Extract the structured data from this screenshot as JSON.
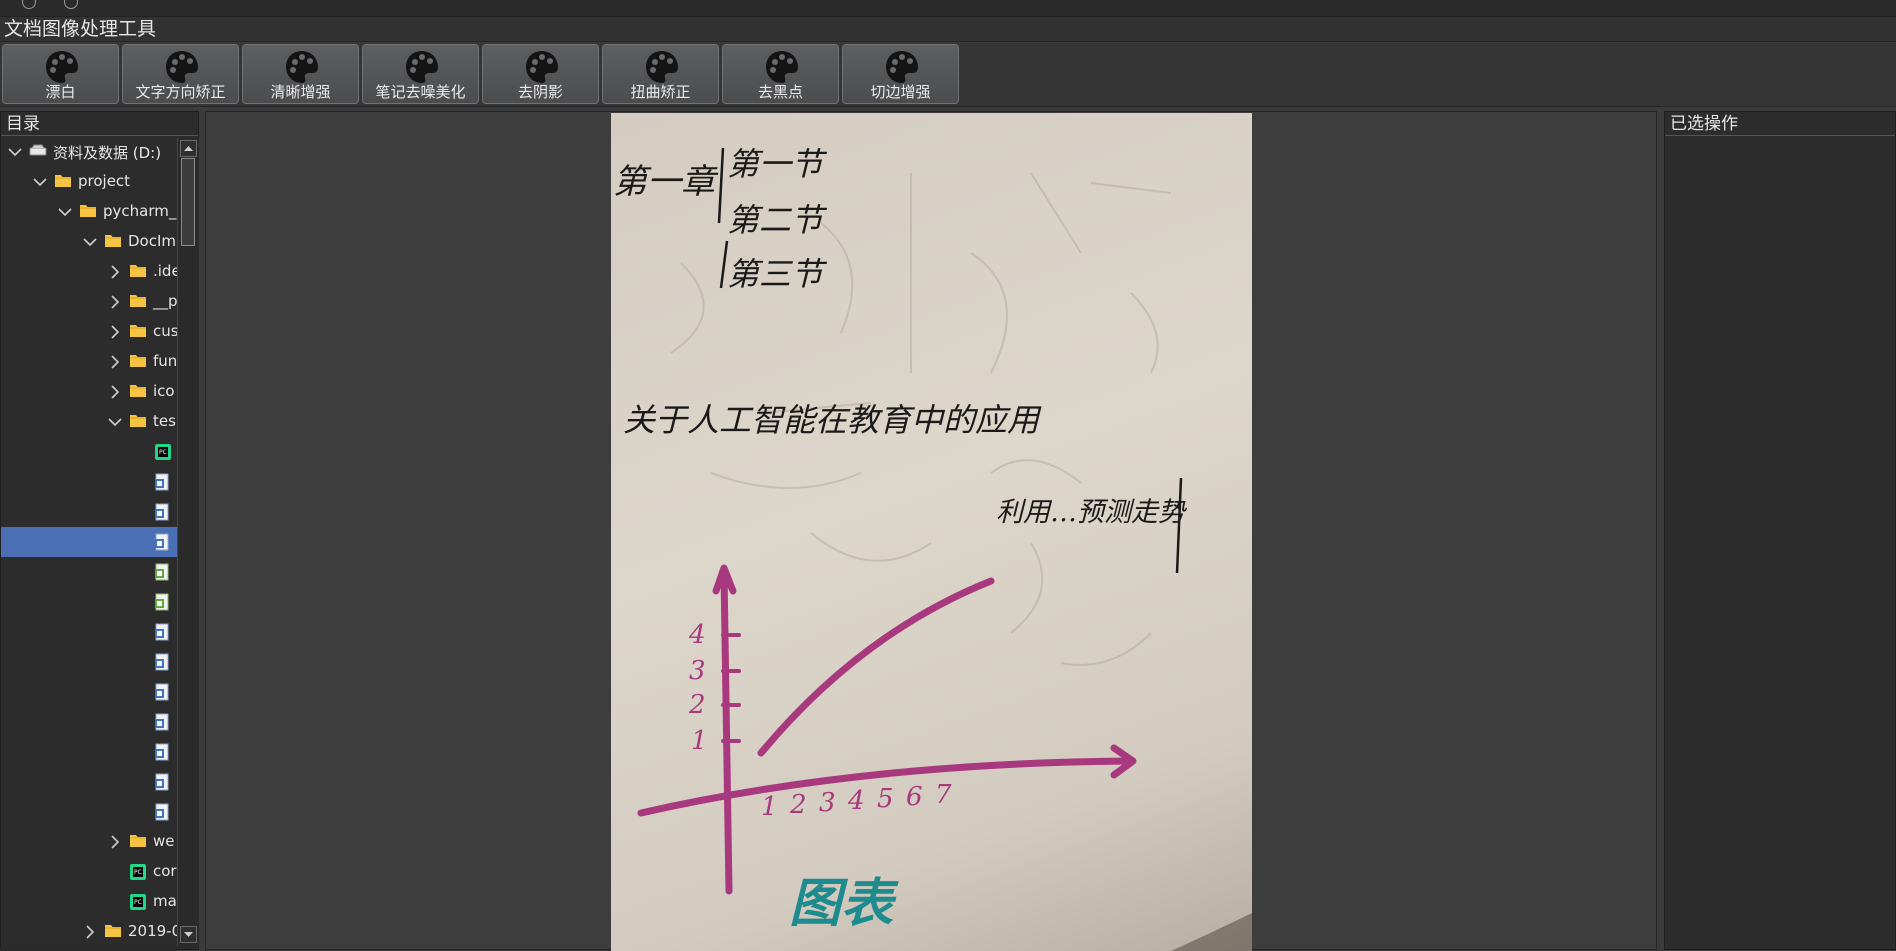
{
  "app": {
    "title": "文档图像处理工具"
  },
  "toolbar": {
    "buttons": [
      {
        "label": "漂白"
      },
      {
        "label": "文字方向矫正"
      },
      {
        "label": "清晰增强"
      },
      {
        "label": "笔记去噪美化"
      },
      {
        "label": "去阴影"
      },
      {
        "label": "扭曲矫正"
      },
      {
        "label": "去黑点"
      },
      {
        "label": "切边增强"
      }
    ]
  },
  "directory": {
    "title": "目录",
    "items": [
      {
        "label": "资料及数据 (D:)",
        "icon": "drive-icon",
        "expand": "down"
      },
      {
        "label": "project",
        "icon": "folder-icon",
        "expand": "down"
      },
      {
        "label": "pycharm_",
        "icon": "folder-icon",
        "expand": "down"
      },
      {
        "label": "DocIm",
        "icon": "folder-icon",
        "expand": "down"
      },
      {
        "label": ".ide",
        "icon": "folder-icon",
        "expand": "right"
      },
      {
        "label": "__p",
        "icon": "folder-icon",
        "expand": "right"
      },
      {
        "label": "cus",
        "icon": "folder-icon",
        "expand": "right"
      },
      {
        "label": "fun",
        "icon": "folder-icon",
        "expand": "right"
      },
      {
        "label": "ico",
        "icon": "folder-icon",
        "expand": "right"
      },
      {
        "label": "tes",
        "icon": "folder-icon",
        "expand": "down"
      },
      {
        "label": "",
        "icon": "pycharm-file-icon",
        "expand": ""
      },
      {
        "label": "",
        "icon": "image-file-icon",
        "expand": ""
      },
      {
        "label": "",
        "icon": "image-file-icon",
        "expand": ""
      },
      {
        "label": "",
        "icon": "image-file-icon",
        "expand": "",
        "selected": true
      },
      {
        "label": "",
        "icon": "green-file-icon",
        "expand": ""
      },
      {
        "label": "",
        "icon": "green-file-icon",
        "expand": ""
      },
      {
        "label": "",
        "icon": "image-file-icon",
        "expand": ""
      },
      {
        "label": "",
        "icon": "image-file-icon",
        "expand": ""
      },
      {
        "label": "",
        "icon": "image-file-icon",
        "expand": ""
      },
      {
        "label": "",
        "icon": "image-file-icon",
        "expand": ""
      },
      {
        "label": "",
        "icon": "image-file-icon",
        "expand": ""
      },
      {
        "label": "",
        "icon": "image-file-icon",
        "expand": ""
      },
      {
        "label": "",
        "icon": "image-file-icon",
        "expand": ""
      },
      {
        "label": "we",
        "icon": "folder-icon",
        "expand": "right"
      },
      {
        "label": "cor",
        "icon": "pycharm-file-icon",
        "expand": ""
      },
      {
        "label": "ma",
        "icon": "pycharm-file-icon",
        "expand": ""
      },
      {
        "label": "2019-0",
        "icon": "folder-icon",
        "expand": "right"
      }
    ]
  },
  "selected_ops": {
    "title": "已选操作"
  },
  "document": {
    "line1_chapter": "第一章",
    "line1_section": "第一节",
    "line2": "第二节",
    "line3": "第三节",
    "sentence": "关于人工智能在教育中的应用",
    "trend_note": "利用…预测走势",
    "chart_caption": "图表",
    "y_ticks": [
      "4",
      "3",
      "2",
      "1"
    ],
    "x_ticks": [
      "1",
      "2",
      "3",
      "4",
      "5",
      "6",
      "7"
    ]
  },
  "colors": {
    "accent_selected": "#4a6fb4",
    "ink_black": "#1a1a1a",
    "ink_magenta": "#a8397f",
    "ink_teal": "#1e8b8e"
  }
}
